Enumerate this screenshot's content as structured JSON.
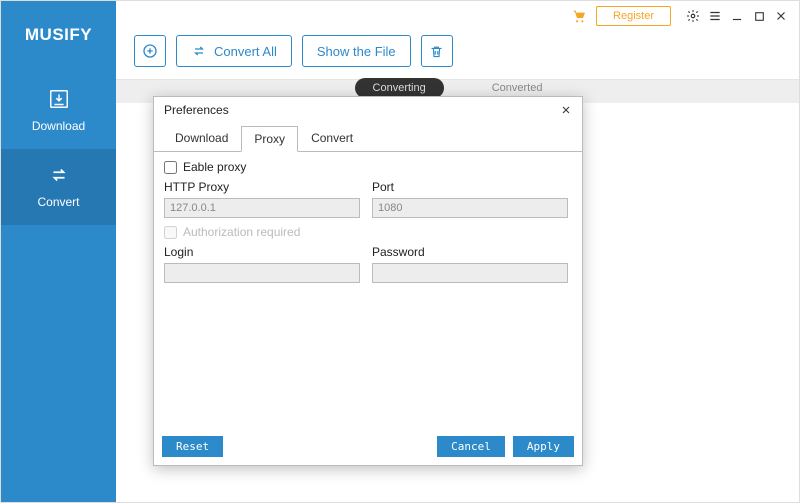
{
  "brand": "MUSIFY",
  "titlebar": {
    "register": "Register"
  },
  "nav": {
    "download": "Download",
    "convert": "Convert"
  },
  "toolbar": {
    "convert_all": "Convert All",
    "show_file": "Show the File"
  },
  "maintabs": {
    "converting": "Converting",
    "converted": "Converted"
  },
  "modal": {
    "title": "Preferences",
    "tabs": {
      "download": "Download",
      "proxy": "Proxy",
      "convert": "Convert"
    },
    "enable_proxy": "Eable proxy",
    "http_proxy_label": "HTTP Proxy",
    "http_proxy_value": "127.0.0.1",
    "port_label": "Port",
    "port_value": "1080",
    "auth_required": "Authorization required",
    "login_label": "Login",
    "login_value": "",
    "password_label": "Password",
    "password_value": "",
    "reset": "Reset",
    "cancel": "Cancel",
    "apply": "Apply"
  }
}
